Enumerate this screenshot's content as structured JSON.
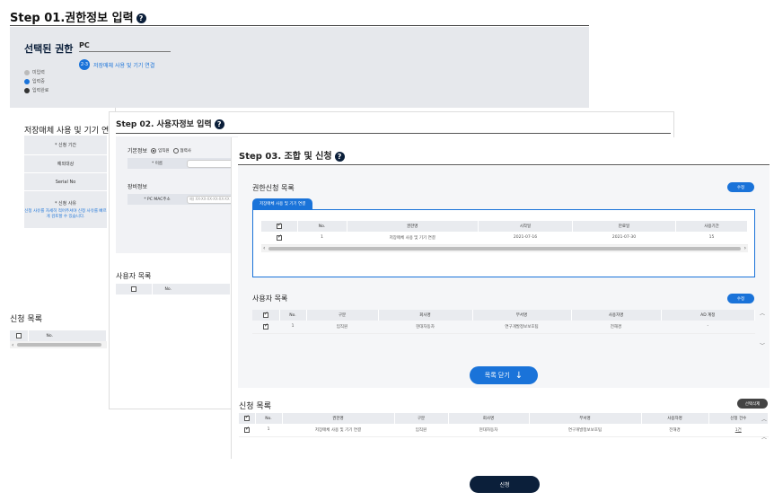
{
  "step1": {
    "title": "Step 01.권한정보 입력",
    "help": "?",
    "selected_label": "선택된 권한",
    "selected_value": "PC",
    "step_num": "2-3",
    "step_text": "저장매체 사용 및 기기 연결",
    "legend": [
      "미입력",
      "입력중",
      "입력완료"
    ],
    "usage_title": "저장매체 사용 및 기기 연",
    "form_rows": [
      "* 신청 기간",
      "예외대상",
      "Serial No",
      "* 신청 사유"
    ],
    "form_note": "신청 사유를 자세히 적어주셔야 신청 사유를 빠르게 검토할 수 있습니다.",
    "req_title": "신청 목록",
    "req_cols": [
      "",
      "No."
    ]
  },
  "step2": {
    "title": "Step 02. 사용자정보 입력",
    "help": "?",
    "basic_label": "기본정보",
    "radio_options": [
      "임직원",
      "협력사"
    ],
    "name_label": "* 이름",
    "equip_label": "장비정보",
    "mac_label": "* PC MAC주소",
    "mac_placeholder": "예) XX-XX-XX-XX-XX-XX",
    "users_title": "사용자 목록",
    "users_cols": [
      "",
      "No."
    ]
  },
  "step3": {
    "title": "Step 03. 조합 및 신청",
    "help": "?",
    "perm_title": "권한신청 목록",
    "edit_label": "수정",
    "tab_label": "저장매체 사용 및 기기 연결",
    "perm_cols": [
      "",
      "No.",
      "권한명",
      "시작일",
      "만료일",
      "사용기간"
    ],
    "perm_rows": [
      {
        "no": "1",
        "name": "저장매체 사용 및 기기 연결",
        "start": "2021-07-16",
        "end": "2021-07-30",
        "days": "15"
      }
    ],
    "user_title": "사용자 목록",
    "user_cols": [
      "",
      "No.",
      "구분",
      "회사명",
      "부서명",
      "사용자명",
      "AD 계정"
    ],
    "user_rows": [
      {
        "no": "1",
        "type": "임직원",
        "company": "현대자동차",
        "dept": "연구개발정보보호팀",
        "name": "전해경",
        "ad": "-"
      }
    ],
    "close_label": "목록 닫기",
    "req_title": "신청 목록",
    "delete_label": "선택삭제",
    "req_cols": [
      "",
      "No.",
      "권한명",
      "구분",
      "회사명",
      "부서명",
      "사용자명",
      "신청 건수"
    ],
    "req_rows": [
      {
        "no": "1",
        "perm": "저장매체 사용 및 기기 연결",
        "type": "임직원",
        "company": "현대자동차",
        "dept": "연구개발정보보호팀",
        "name": "전해경",
        "count": "1건"
      }
    ],
    "submit_label": "신청"
  },
  "colors": {
    "primary": "#1a73d9",
    "navy": "#0b1f3a",
    "panel": "#e6e8ec"
  }
}
